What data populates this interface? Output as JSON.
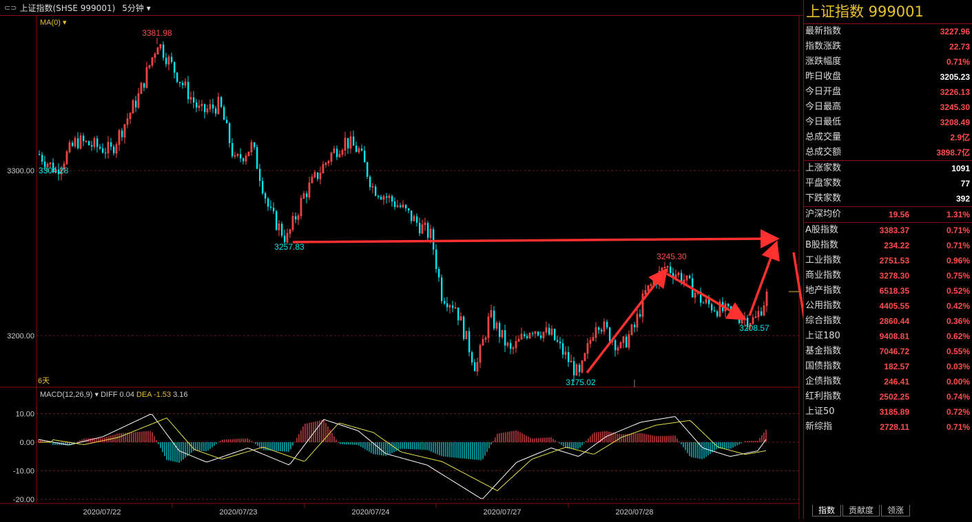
{
  "window": {
    "title": "上证指数(SHSE 999001)",
    "period": "5分钟"
  },
  "ma_label": "MA(0)",
  "days_label": "6天",
  "macd": {
    "label": "MACD(12,26,9)",
    "diff_label": "DIFF",
    "diff": "0.04",
    "dea_label": "DEA",
    "dea": "-1.53",
    "macd": "3.16"
  },
  "colors": {
    "up": "#ff4c4c",
    "down": "#00e5ee",
    "axis": "#8a1010",
    "title": "#e8c22c"
  },
  "price_axis": {
    "ticks": [
      "3300.00",
      "3200.00"
    ]
  },
  "macd_axis": {
    "ticks": [
      "10.00",
      "0.00",
      "-10.00",
      "-20.00"
    ]
  },
  "date_axis": [
    "2020/07/22",
    "2020/07/23",
    "2020/07/24",
    "2020/07/27",
    "2020/07/28"
  ],
  "annotations": {
    "high1": "3381.98",
    "start": "3304.28",
    "low1": "3257.83",
    "low2": "3175.02",
    "high2": "3245.30",
    "low3": "3208.57"
  },
  "panel": {
    "title": "上证指数  999001",
    "quote": [
      {
        "label": "最新指数",
        "value": "3227.96",
        "color": "red"
      },
      {
        "label": "指数涨跌",
        "value": "22.73",
        "color": "red"
      },
      {
        "label": "涨跌幅度",
        "value": "0.71%",
        "color": "red"
      },
      {
        "label": "昨日收盘",
        "value": "3205.23",
        "color": "white"
      },
      {
        "label": "今日开盘",
        "value": "3226.13",
        "color": "red"
      },
      {
        "label": "今日最高",
        "value": "3245.30",
        "color": "red"
      },
      {
        "label": "今日最低",
        "value": "3208.49",
        "color": "red"
      },
      {
        "label": "总成交量",
        "value": "2.9亿",
        "color": "red"
      },
      {
        "label": "总成交额",
        "value": "3898.7亿",
        "color": "red"
      }
    ],
    "breadth": [
      {
        "label": "上涨家数",
        "value": "1091"
      },
      {
        "label": "平盘家数",
        "value": "77"
      },
      {
        "label": "下跌家数",
        "value": "392"
      }
    ],
    "avg": {
      "label": "沪深均价",
      "value": "19.56",
      "pct": "1.31%"
    },
    "indices": [
      {
        "label": "A股指数",
        "value": "3383.37",
        "pct": "0.71%"
      },
      {
        "label": "B股指数",
        "value": "234.22",
        "pct": "0.71%"
      },
      {
        "label": "工业指数",
        "value": "2751.53",
        "pct": "0.96%"
      },
      {
        "label": "商业指数",
        "value": "3278.30",
        "pct": "0.75%"
      },
      {
        "label": "地产指数",
        "value": "6518.35",
        "pct": "0.52%"
      },
      {
        "label": "公用指数",
        "value": "4405.55",
        "pct": "0.42%"
      },
      {
        "label": "综合指数",
        "value": "2860.44",
        "pct": "0.36%"
      },
      {
        "label": "上证180",
        "value": "9408.81",
        "pct": "0.62%"
      },
      {
        "label": "基金指数",
        "value": "7046.72",
        "pct": "0.55%"
      },
      {
        "label": "国债指数",
        "value": "182.57",
        "pct": "0.03%"
      },
      {
        "label": "企债指数",
        "value": "246.41",
        "pct": "0.00%"
      },
      {
        "label": "红利指数",
        "value": "2502.25",
        "pct": "0.74%"
      },
      {
        "label": "上证50",
        "value": "3185.89",
        "pct": "0.72%"
      },
      {
        "label": "新综指",
        "value": "2728.11",
        "pct": "0.71%"
      }
    ],
    "tabs": [
      "指数",
      "贡献度",
      "领涨"
    ]
  }
}
